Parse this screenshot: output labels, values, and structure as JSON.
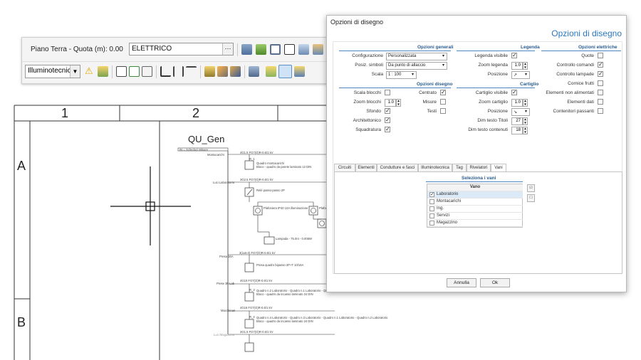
{
  "toolbar": {
    "floor_label": "Piano Terra - Quota (m): 0.00",
    "layer_value": "ELETTRICO",
    "dots": "···",
    "mode_select": "Illuminotecnica"
  },
  "drawing": {
    "col_labels": [
      "1",
      "2"
    ],
    "row_labels": [
      "A",
      "B"
    ],
    "panel_title": "QU_Gen",
    "header_text": "IN = Scheduci Misure",
    "circuits": [
      {
        "name": "Montacarichi",
        "cable": "4G1.5 FG7(O)R-0.6/1 kV",
        "desc1": "Quadro montacarichi",
        "desc2": "Bloco - quadro da parete laminato 12 DIN"
      },
      {
        "name": "Luci Laboratorio",
        "cable": "3G2.5 FG7(O)R-0.6/1 kV",
        "desc1": "Relè passo-passo 2P",
        "desc2": ""
      },
      {
        "name": "Presa 16A",
        "cable": "3(1x6.0) FG7(O)R-0.6/1 kV",
        "desc1": "Presa quadro bipasso 2P+T 10/16A",
        "desc2": ""
      },
      {
        "name": "Prese 3F Lab",
        "cable": "4G10 FG7(O)R-0.6/1 kV",
        "desc1": "Quadro n.2 Laboratorio - Quadro n.1 Laboratorio - Quadro n.1 Laboratorio - Quadro n.2 La",
        "desc2": "Bloco - quadro da incasso laminato 24 DIN"
      },
      {
        "name": "Macchinari",
        "cable": "4G16 FG7(O)R-0.6/1 kV",
        "desc1": "Quadro n.4 Laboratorio - Quadro n.3 Laboratorio - Quadro n.1 Laboratorio - Quadro n.2 Laboratorio",
        "desc2": "Bloco - quadro da incasso laminato 24 DIN"
      },
      {
        "name": "Luci Magazzino",
        "cable": "3G1.5 FG7(O)R-0.6/1 kV",
        "desc1": "",
        "desc2": ""
      }
    ],
    "lamp_label1": "Plafoniera IP40 10A illuminazione",
    "lamp_label2": "Plafon",
    "lamp_label3": "Lampada - 75.0m - 0.005W",
    "rn_label": "R_1",
    "rn_label2": "R_3",
    "rn_label3": "R_4"
  },
  "dialog": {
    "window_title": "Opzioni di disegno",
    "heading": "Opzioni di disegno",
    "sections": {
      "generali": "Opzioni generali",
      "legenda": "Legenda",
      "elettriche": "Opzioni elettriche",
      "disegno": "Opzioni disegno",
      "cartiglio": "Cartiglio"
    },
    "generali": {
      "configurazione_label": "Configurazione",
      "configurazione_value": "Personalizzata",
      "posiz_label": "Posiz. simboli",
      "posiz_value": "Da punto di allaccio",
      "scala_label": "Scala",
      "scala_value": "1 : 100"
    },
    "legenda": {
      "visibile_label": "Legenda visibile",
      "visibile": true,
      "zoom_label": "Zoom legenda",
      "zoom_value": "1.0",
      "posizione_label": "Posizione",
      "posizione_value": "↗"
    },
    "elettriche": [
      {
        "label": "Quote",
        "checked": false
      },
      {
        "label": "Controllo comandi",
        "checked": true
      },
      {
        "label": "Controllo lampade",
        "checked": true
      },
      {
        "label": "Cornice frutti",
        "checked": false
      },
      {
        "label": "Elementi non alimentati",
        "checked": false
      },
      {
        "label": "Elementi dati",
        "checked": false
      },
      {
        "label": "Contenitori passanti",
        "checked": false
      }
    ],
    "disegno_left": {
      "scala_blocchi_label": "Scala blocchi",
      "scala_blocchi": false,
      "zoom_blocchi_label": "Zoom blocchi",
      "zoom_blocchi_value": "1.0",
      "sfondo_label": "Sfondo",
      "sfondo": true,
      "architettonico_label": "Architettonico",
      "architettonico": true,
      "squadratura_label": "Squadratura",
      "squadratura": true
    },
    "disegno_right": {
      "centrato_label": "Centrato",
      "centrato": true,
      "misure_label": "Misure",
      "misure": false,
      "testi_label": "Testi",
      "testi": false
    },
    "cartiglio": {
      "visibile_label": "Cartiglio visibile",
      "visibile": true,
      "zoom_label": "Zoom cartiglio",
      "zoom_value": "1.0",
      "posizione_label": "Posizione",
      "posizione_value": "↘",
      "titoli_label": "Dim testo Titoli",
      "titoli_value": "27",
      "contenuti_label": "Dim testo contenuti",
      "contenuti_value": "18"
    },
    "tabs": [
      "Circuiti",
      "Elementi",
      "Condutture e fasci",
      "Illuminotecnica",
      "Tag",
      "Rivelatori",
      "Vani"
    ],
    "active_tab": "Vani",
    "vani": {
      "section_title": "Seleziona i vani",
      "column": "Vano",
      "rows": [
        {
          "label": "Laboratorio",
          "checked": true
        },
        {
          "label": "Montacarichi",
          "checked": false
        },
        {
          "label": "Ing.",
          "checked": false
        },
        {
          "label": "Servizi",
          "checked": false
        },
        {
          "label": "Magazzino",
          "checked": false
        }
      ]
    },
    "buttons": {
      "cancel": "Annulla",
      "ok": "Ok"
    }
  },
  "colors": {
    "accent": "#2a78c2",
    "section": "#2b5d8e",
    "selected_row": "#dce9f7"
  }
}
